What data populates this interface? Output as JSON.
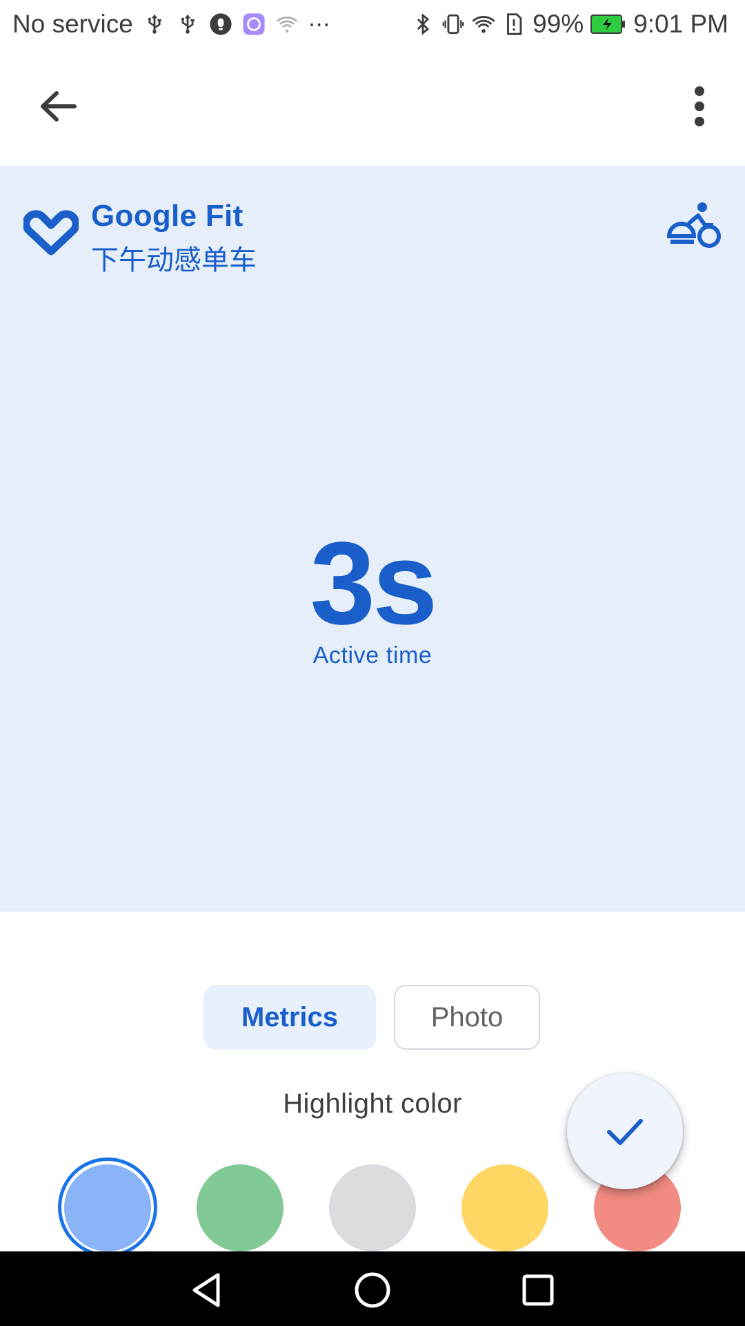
{
  "status_bar": {
    "carrier": "No service",
    "battery": "99%",
    "time": "9:01 PM"
  },
  "app_bar": {
    "back_icon": "arrow-back-icon",
    "menu_icon": "more-vert-icon"
  },
  "preview": {
    "brand": "Google Fit",
    "activity_title": "下午动感单车",
    "activity_icon": "cycling-icon",
    "metric_value": "3s",
    "metric_label": "Active time",
    "text_color": "#1a5fc9",
    "background": "#e6eefa"
  },
  "tabs": [
    {
      "label": "Metrics",
      "selected": true
    },
    {
      "label": "Photo",
      "selected": false
    }
  ],
  "highlight": {
    "title": "Highlight color",
    "swatches": [
      {
        "color": "#8ab4f8",
        "selected": true
      },
      {
        "color": "#81c995",
        "selected": false
      },
      {
        "color": "#dadce0",
        "selected": false
      },
      {
        "color": "#fdd663",
        "selected": false
      },
      {
        "color": "#f28b82",
        "selected": false
      }
    ]
  },
  "fab": {
    "icon": "check-icon"
  }
}
